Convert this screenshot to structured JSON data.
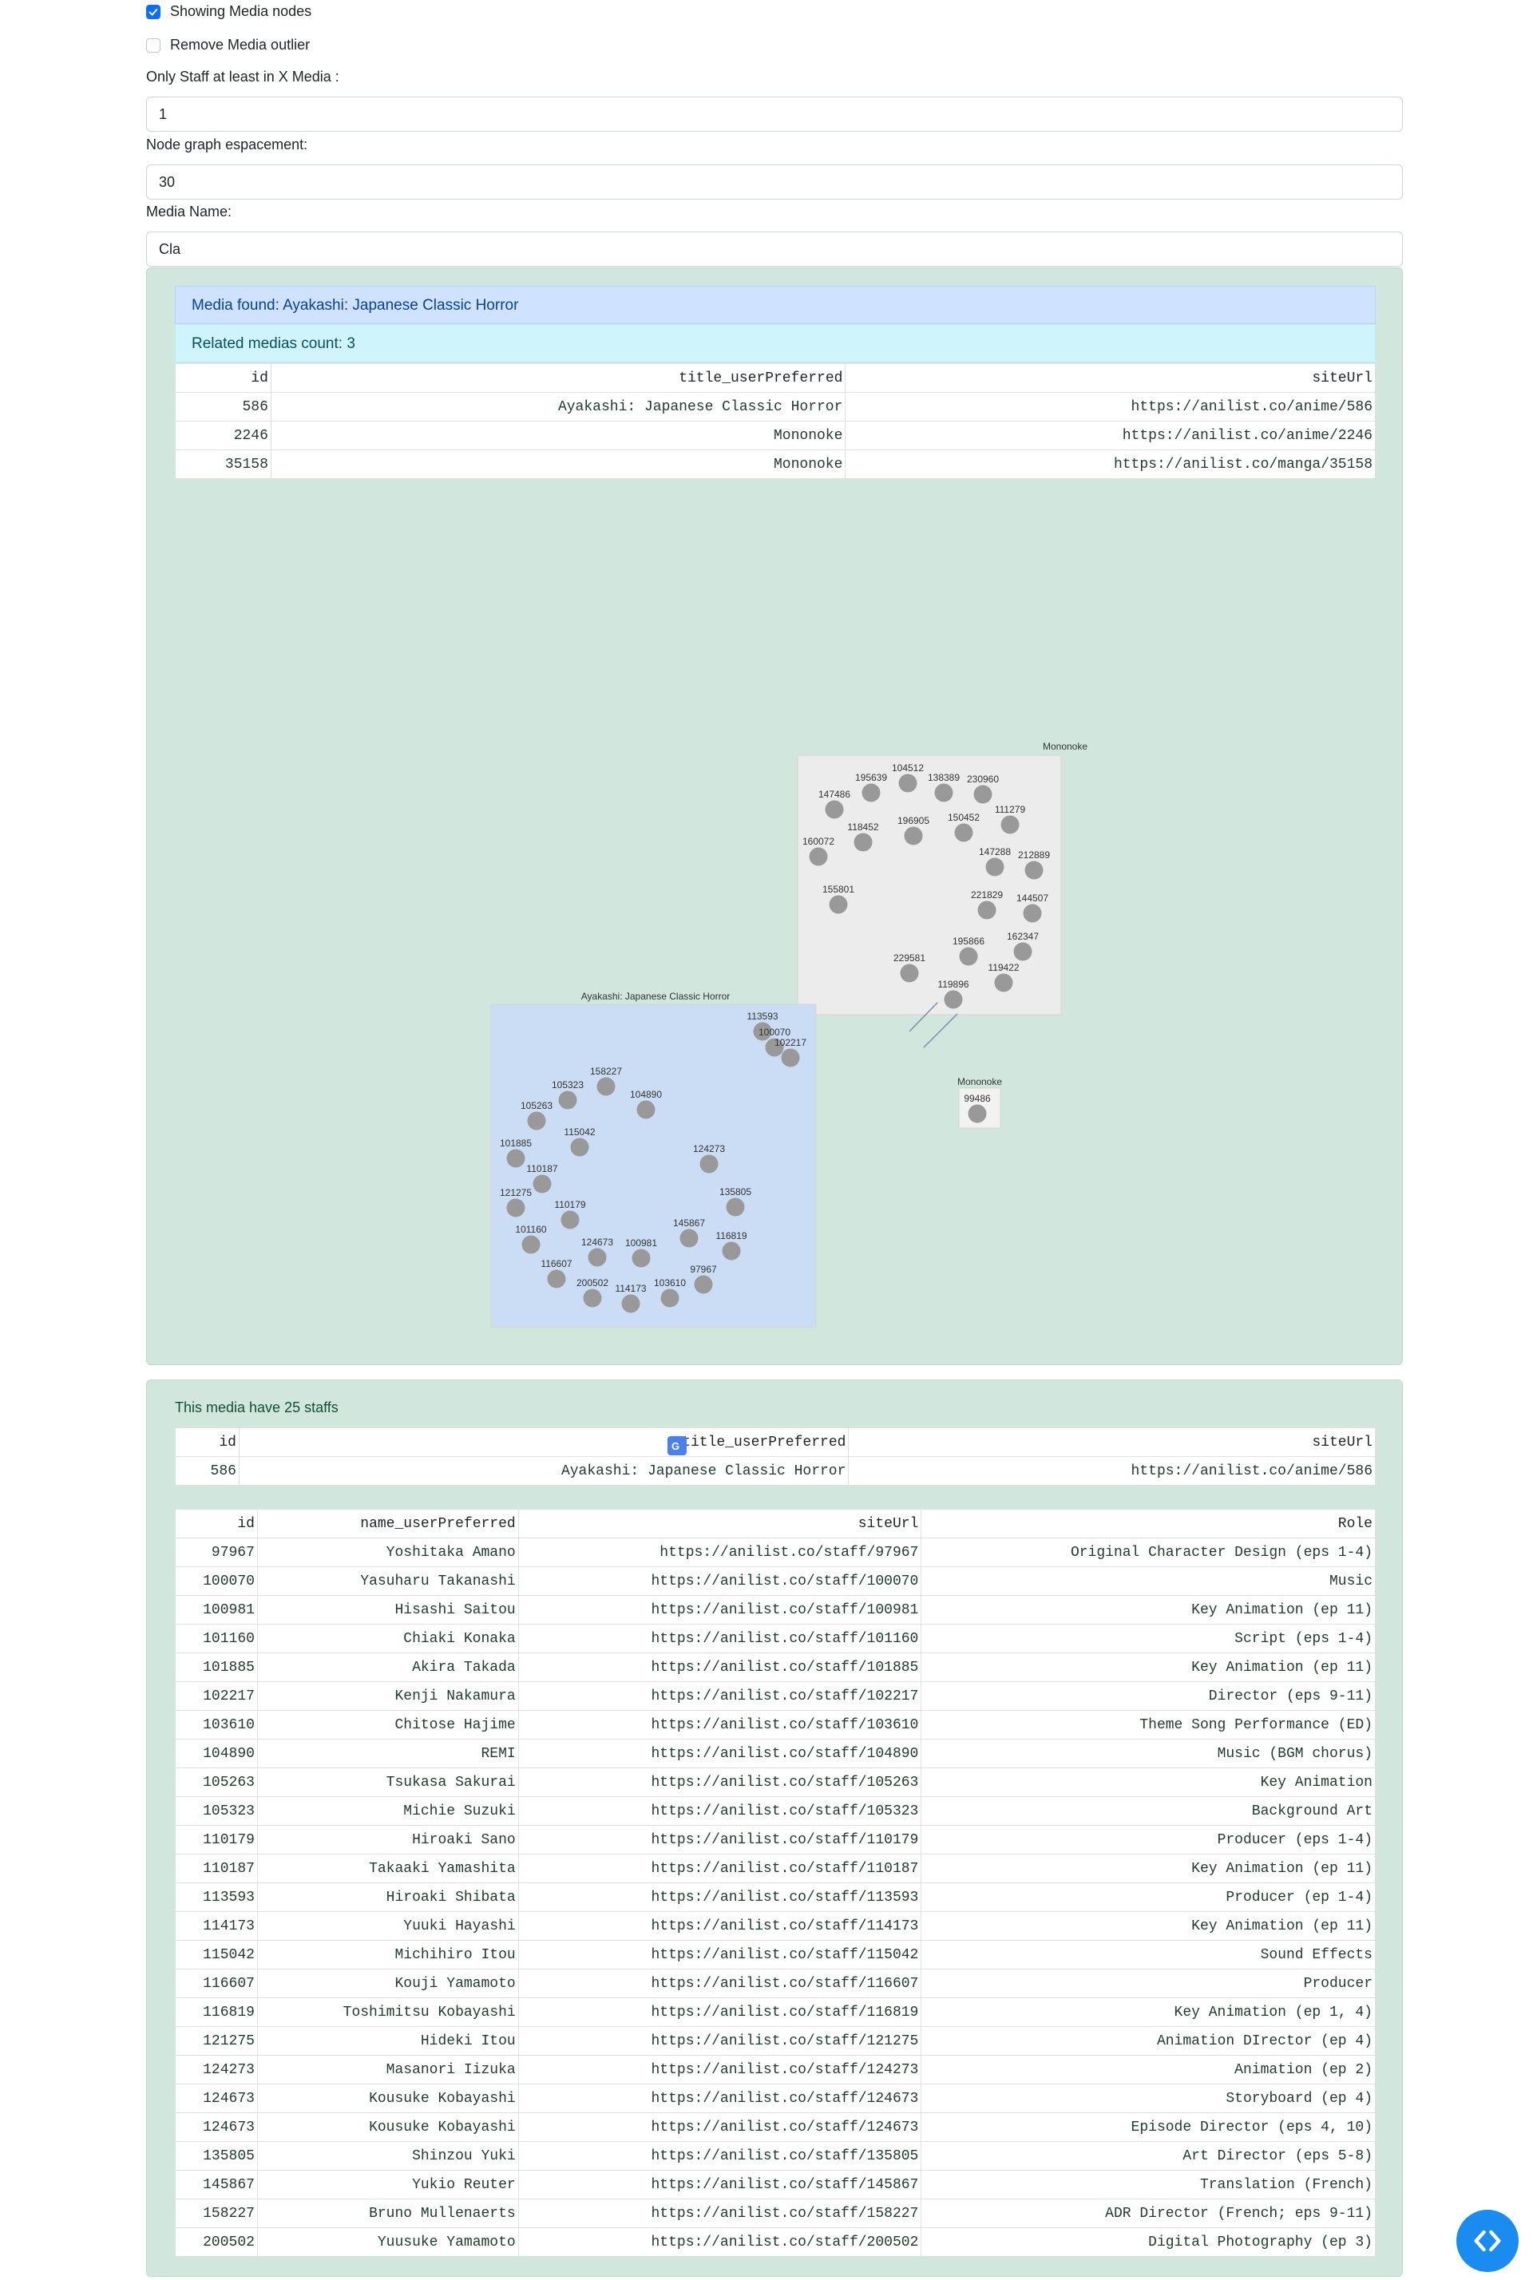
{
  "controls": {
    "showing_media_nodes": {
      "label": "Showing Media nodes",
      "checked": true
    },
    "remove_media_outlier": {
      "label": "Remove Media outlier",
      "checked": false
    },
    "min_staff_label": "Only Staff at least in X Media :",
    "min_staff_value": "1",
    "spacing_label": "Node graph espacement:",
    "spacing_value": "30",
    "media_name_label": "Media Name:",
    "media_name_value": "Cla"
  },
  "results": {
    "media_found": "Media found: Ayakashi: Japanese Classic Horror",
    "related_count": "Related medias count: 3",
    "related_table": {
      "columns": [
        "id",
        "title_userPreferred",
        "siteUrl"
      ],
      "rows": [
        [
          "586",
          "Ayakashi: Japanese Classic Horror",
          "https://anilist.co/anime/586"
        ],
        [
          "2246",
          "Mononoke",
          "https://anilist.co/anime/2246"
        ],
        [
          "35158",
          "Mononoke",
          "https://anilist.co/manga/35158"
        ]
      ]
    }
  },
  "graph": {
    "groups": [
      {
        "title": "Mononoke",
        "color": "#ececec",
        "nodes": [
          "195639",
          "104512",
          "138389",
          "230960",
          "147486",
          "196905",
          "150452",
          "111279",
          "118452",
          "160072",
          "147288",
          "212889",
          "155801",
          "221829",
          "144507",
          "162347",
          "195866",
          "229581",
          "119422",
          "119896"
        ]
      },
      {
        "title": "Ayakashi: Japanese Classic Horror",
        "color": "#cbdcf5",
        "nodes": [
          "113593",
          "100070",
          "102217",
          "158227",
          "105323",
          "104890",
          "105263",
          "115042",
          "101885",
          "110187",
          "124273",
          "121275",
          "135805",
          "110179",
          "145867",
          "101160",
          "124673",
          "100981",
          "116819",
          "116607",
          "97967",
          "200502",
          "114173",
          "103610"
        ]
      },
      {
        "title": "Mononoke",
        "color": "#f2f2f2",
        "nodes": [
          "99486"
        ]
      }
    ],
    "node_color": "#999999"
  },
  "staff_section": {
    "heading": "This media have 25 staffs",
    "media_table": {
      "columns": [
        "id",
        "title_userPreferred",
        "siteUrl"
      ],
      "rows": [
        [
          "586",
          "Ayakashi: Japanese Classic Horror",
          "https://anilist.co/anime/586"
        ]
      ]
    },
    "staff_table": {
      "columns": [
        "id",
        "name_userPreferred",
        "siteUrl",
        "Role"
      ],
      "rows": [
        [
          "97967",
          "Yoshitaka Amano",
          "https://anilist.co/staff/97967",
          "Original Character Design (eps 1-4)"
        ],
        [
          "100070",
          "Yasuharu Takanashi",
          "https://anilist.co/staff/100070",
          "Music"
        ],
        [
          "100981",
          "Hisashi Saitou",
          "https://anilist.co/staff/100981",
          "Key Animation (ep 11)"
        ],
        [
          "101160",
          "Chiaki Konaka",
          "https://anilist.co/staff/101160",
          "Script (eps 1-4)"
        ],
        [
          "101885",
          "Akira Takada",
          "https://anilist.co/staff/101885",
          "Key Animation (ep 11)"
        ],
        [
          "102217",
          "Kenji Nakamura",
          "https://anilist.co/staff/102217",
          "Director (eps 9-11)"
        ],
        [
          "103610",
          "Chitose Hajime",
          "https://anilist.co/staff/103610",
          "Theme Song Performance (ED)"
        ],
        [
          "104890",
          "REMI",
          "https://anilist.co/staff/104890",
          "Music (BGM chorus)"
        ],
        [
          "105263",
          "Tsukasa Sakurai",
          "https://anilist.co/staff/105263",
          "Key Animation"
        ],
        [
          "105323",
          "Michie Suzuki",
          "https://anilist.co/staff/105323",
          "Background Art"
        ],
        [
          "110179",
          "Hiroaki Sano",
          "https://anilist.co/staff/110179",
          "Producer (eps 1-4)"
        ],
        [
          "110187",
          "Takaaki Yamashita",
          "https://anilist.co/staff/110187",
          "Key Animation (ep 11)"
        ],
        [
          "113593",
          "Hiroaki Shibata",
          "https://anilist.co/staff/113593",
          "Producer (ep 1-4)"
        ],
        [
          "114173",
          "Yuuki Hayashi",
          "https://anilist.co/staff/114173",
          "Key Animation (ep 11)"
        ],
        [
          "115042",
          "Michihiro Itou",
          "https://anilist.co/staff/115042",
          "Sound Effects"
        ],
        [
          "116607",
          "Kouji Yamamoto",
          "https://anilist.co/staff/116607",
          "Producer"
        ],
        [
          "116819",
          "Toshimitsu Kobayashi",
          "https://anilist.co/staff/116819",
          "Key Animation (ep 1, 4)"
        ],
        [
          "121275",
          "Hideki Itou",
          "https://anilist.co/staff/121275",
          "Animation DIrector (ep 4)"
        ],
        [
          "124273",
          "Masanori Iizuka",
          "https://anilist.co/staff/124273",
          "Animation (ep 2)"
        ],
        [
          "124673",
          "Kousuke Kobayashi",
          "https://anilist.co/staff/124673",
          "Storyboard (ep 4)"
        ],
        [
          "124673",
          "Kousuke Kobayashi",
          "https://anilist.co/staff/124673",
          "Episode Director (eps 4, 10)"
        ],
        [
          "135805",
          "Shinzou Yuki",
          "https://anilist.co/staff/135805",
          "Art Director (eps 5-8)"
        ],
        [
          "145867",
          "Yukio Reuter",
          "https://anilist.co/staff/145867",
          "Translation (French)"
        ],
        [
          "158227",
          "Bruno Mullenaerts",
          "https://anilist.co/staff/158227",
          "ADR Director (French; eps 9-11)"
        ],
        [
          "200502",
          "Yuusuke Yamamoto",
          "https://anilist.co/staff/200502",
          "Digital Photography (ep 3)"
        ]
      ]
    }
  },
  "icons": {
    "translate": "translate-icon",
    "embed": "code-icon"
  },
  "colors": {
    "accent": "#0d6efd",
    "panel": "#d1e7dd",
    "fab": "#1a8cf0"
  }
}
